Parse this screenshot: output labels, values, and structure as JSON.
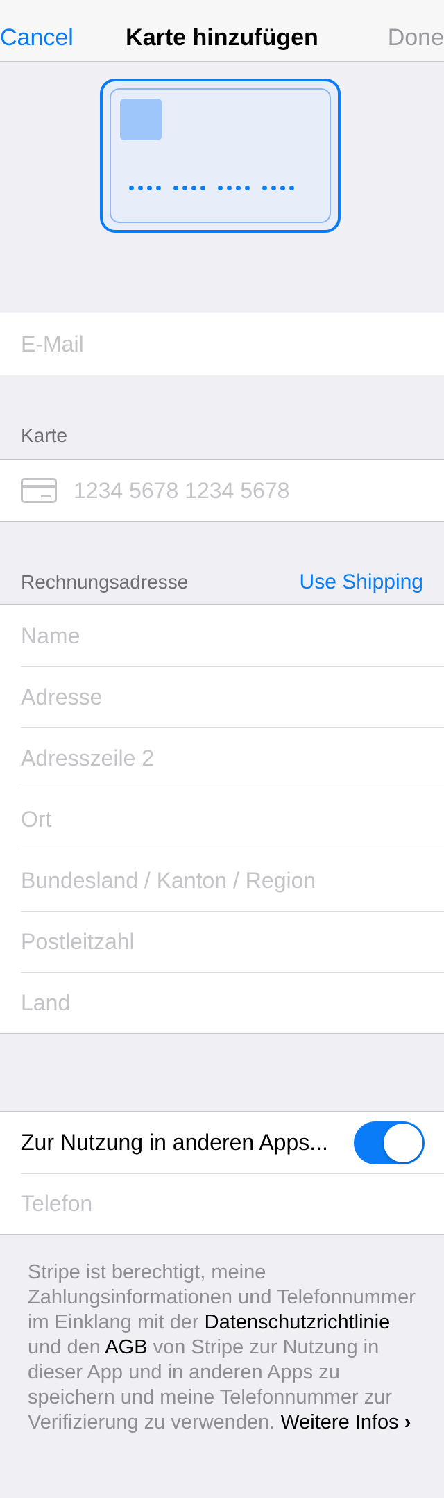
{
  "nav": {
    "cancel": "Cancel",
    "title": "Karte hinzufügen",
    "done": "Done"
  },
  "colors": {
    "accent": "#0a7cf7",
    "background": "#efeff4",
    "placeholder": "#c4c4c8"
  },
  "email": {
    "placeholder": "E-Mail"
  },
  "card_section": {
    "header": "Karte",
    "number_placeholder": "1234 5678 1234 5678",
    "icon": "credit-card-icon"
  },
  "billing": {
    "header": "Rechnungsadresse",
    "use_shipping": "Use Shipping",
    "fields": {
      "name": "Name",
      "address": "Adresse",
      "address2": "Adresszeile 2",
      "city": "Ort",
      "state": "Bundesland / Kanton / Region",
      "zip": "Postleitzahl",
      "country": "Land"
    }
  },
  "link": {
    "toggle_label": "Zur Nutzung in anderen Apps...",
    "toggle_on": true,
    "phone_placeholder": "Telefon"
  },
  "footer": {
    "part1": "Stripe ist berechtigt, meine Zahlungsinformationen und Telefonnummer im Einklang mit der ",
    "privacy": "Datenschutzrichtlinie",
    "part2": " und den ",
    "terms": "AGB",
    "part3": " von Stripe zur Nutzung in dieser App und in anderen Apps zu speichern und meine Telefonnummer zur Verifizierung zu verwenden. ",
    "more": "Weitere Infos",
    "more_chevron": "›"
  }
}
